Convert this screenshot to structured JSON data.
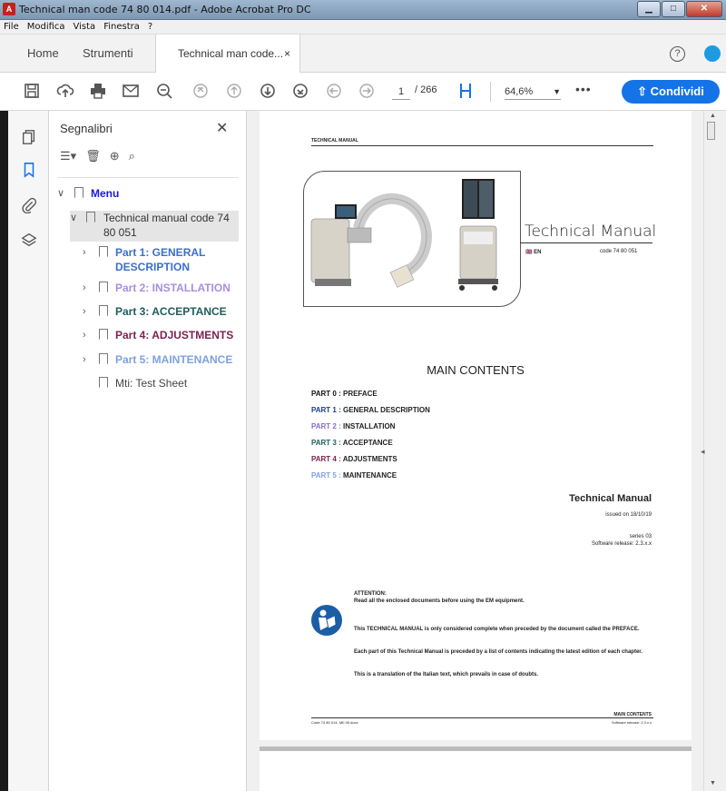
{
  "window": {
    "title": "Technical man code 74 80 014.pdf - Adobe Acrobat Pro DC",
    "app_icon": "acrobat-icon"
  },
  "menu": [
    "File",
    "Modifica",
    "Vista",
    "Finestra",
    "?"
  ],
  "tabs": {
    "home": "Home",
    "tools": "Strumenti",
    "doc": "Technical man code...",
    "doc_close": "×"
  },
  "toolbar": {
    "page_current": "1",
    "page_total": "/ 266",
    "zoom": "64,6%",
    "more": "•••",
    "share": "Condividi"
  },
  "bookmarks": {
    "title": "Segnalibri",
    "close": "✕",
    "items": [
      {
        "label": "Menu",
        "color": "#1a1adb"
      },
      {
        "label_line1": "Technical manual code 74",
        "label_line2": "80 051",
        "color": "#333333"
      },
      {
        "label_line1": "Part 1: GENERAL",
        "label_line2": "DESCRIPTION",
        "color": "#3a6fc9"
      },
      {
        "label": "Part 2: INSTALLATION",
        "color": "#a98ee0"
      },
      {
        "label": "Part 3: ACCEPTANCE",
        "color": "#1f5c5c"
      },
      {
        "label": "Part 4: ADJUSTMENTS",
        "color": "#7a2250"
      },
      {
        "label": "Part 5: MAINTENANCE",
        "color": "#7fa0e0"
      },
      {
        "label": "Mti: Test Sheet",
        "color": "#444444"
      }
    ]
  },
  "page": {
    "header": "TECHNICAL MANUAL",
    "tm_title": "Technical Manual",
    "lang": "EN",
    "code": "code 74 80 051",
    "contents_title": "MAIN CONTENTS",
    "parts": [
      {
        "num": "PART 0 :",
        "name": "PREFACE",
        "color": "#111111"
      },
      {
        "num": "PART 1 :",
        "name": "GENERAL DESCRIPTION",
        "color": "#1c3d8c"
      },
      {
        "num": "PART 2 :",
        "name": "INSTALLATION",
        "color": "#8a6ad0"
      },
      {
        "num": "PART 3 :",
        "name": "ACCEPTANCE",
        "color": "#1f5c5c"
      },
      {
        "num": "PART 4 :",
        "name": "ADJUSTMENTS",
        "color": "#7a2250"
      },
      {
        "num": "PART 5 :",
        "name": "MAINTENANCE",
        "color": "#7fa0e0"
      }
    ],
    "tech_manual": "Technical Manual",
    "issued": "issued on 18/10/19",
    "series": "series 03",
    "software": "Software release: 2.3.x.x",
    "attention_title": "ATTENTION:",
    "attention_1": "Read all the enclosed documents before using the EM equipment.",
    "attention_2": "This TECHNICAL MANUAL is only considered complete when preceded by the document called the PREFACE.",
    "attention_3": "Each part of this Technical Manual is preceded by a list of contents indicating the latest edition of each chapter.",
    "attention_4": "This is a translation of the Italian text, which prevails in case of doubts.",
    "footer_left": "Code 74 80 014- MII 00.docx",
    "footer_right_1": "MAIN CONTENTS",
    "footer_right_2": "Software release: 2.3.x.x"
  }
}
